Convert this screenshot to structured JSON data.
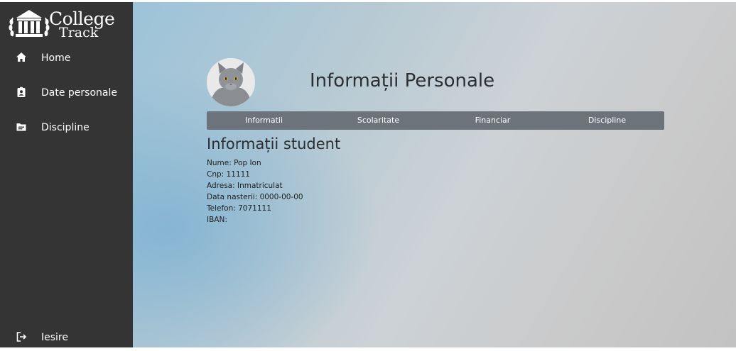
{
  "app": {
    "logo_line1": "College",
    "logo_line2": "Track"
  },
  "sidebar": {
    "items": [
      {
        "label": "Home",
        "icon": "home-icon"
      },
      {
        "label": "Date personale",
        "icon": "id-badge-icon"
      },
      {
        "label": "Discipline",
        "icon": "folder-icon"
      }
    ],
    "logout": {
      "label": "Iesire",
      "icon": "logout-icon"
    }
  },
  "header": {
    "title": "Informații Personale",
    "avatar": "cat-avatar"
  },
  "tabs": [
    "Informatii",
    "Scolaritate",
    "Financiar",
    "Discipline"
  ],
  "student": {
    "section_title": "Informații student",
    "fields": [
      "Nume: Pop Ion",
      "Cnp: 11111",
      "Adresa: Inmatriculat",
      "Data nasterii: 0000-00-00",
      "Telefon: 7071111",
      "IBAN:"
    ]
  },
  "colors": {
    "sidebar": "#343434",
    "tab_bar": "#6c737b",
    "text": "#2b2f33"
  }
}
